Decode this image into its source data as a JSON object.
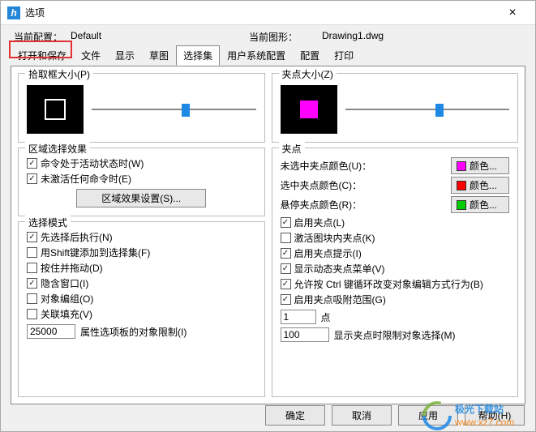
{
  "window": {
    "title": "选项",
    "close": "×"
  },
  "info": {
    "current_config_label": "当前配置：",
    "current_config_value": "Default",
    "current_drawing_label": "当前图形：",
    "current_drawing_value": "Drawing1.dwg"
  },
  "tabs": {
    "open_save": "打开和保存",
    "file": "文件",
    "display": "显示",
    "sketch": "草图",
    "selection": "选择集",
    "user_prefs": "用户系统配置",
    "config": "配置",
    "print": "打印"
  },
  "left": {
    "pickbox": {
      "title": "拾取框大小(P)"
    },
    "area_effect": {
      "title": "区域选择效果",
      "chk_active": "命令处于活动状态时(W)",
      "chk_inactive": "未激活任何命令时(E)",
      "btn_settings": "区域效果设置(S)..."
    },
    "select_mode": {
      "title": "选择模式",
      "chk1": "先选择后执行(N)",
      "chk2": "用Shift键添加到选择集(F)",
      "chk3": "按住并拖动(D)",
      "chk4": "隐含窗口(I)",
      "chk5": "对象编组(O)",
      "chk6": "关联填充(V)",
      "limit_value": "25000",
      "limit_label": "属性选项板的对象限制(I)"
    }
  },
  "right": {
    "gripsize": {
      "title": "夹点大小(Z)"
    },
    "grips": {
      "title": "夹点",
      "unsel_label": "未选中夹点颜色(U)：",
      "sel_label": "选中夹点颜色(C)：",
      "hover_label": "悬停夹点颜色(R)：",
      "color_btn": "颜色...",
      "colors": {
        "unsel": "#ff00ff",
        "sel": "#ff0000",
        "hover": "#00cc00"
      },
      "chk_enable": "启用夹点(L)",
      "chk_block": "激活图块内夹点(K)",
      "chk_tips": "启用夹点提示(I)",
      "chk_dynmenu": "显示动态夹点菜单(V)",
      "chk_ctrl": "允许按 Ctrl 键循环改变对象编辑方式行为(B)",
      "chk_snap": "启用夹点吸附范围(G)",
      "pts_value": "1",
      "pts_label": "点",
      "limit_value": "100",
      "limit_label": "显示夹点时限制对象选择(M)"
    }
  },
  "footer": {
    "ok": "确定",
    "cancel": "取消",
    "apply": "应用",
    "help": "帮助(H)"
  },
  "watermark": {
    "line1": "极光下载站",
    "line2": "www.xz7.com"
  }
}
